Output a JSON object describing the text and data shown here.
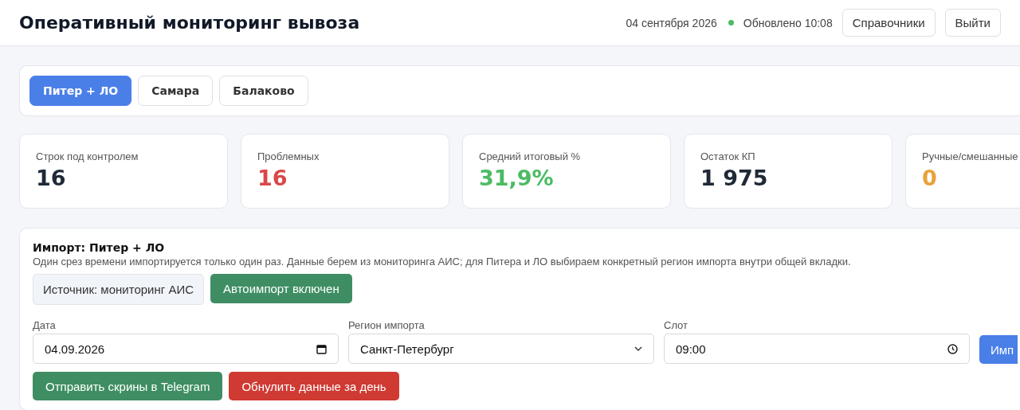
{
  "header": {
    "title": "Оперативный мониторинг вывоза",
    "date": "04 сентября 2026",
    "status": {
      "online": true,
      "text": "Обновлено 10:08"
    },
    "buttons": [
      "Справочники",
      "Выйти"
    ]
  },
  "tabs": [
    {
      "label": "Питер + ЛО",
      "selected": true
    },
    {
      "label": "Самара",
      "selected": false
    },
    {
      "label": "Балаково",
      "selected": false
    }
  ],
  "stats": [
    {
      "label": "Строк под контролем",
      "value": "16",
      "color": "#1f2937"
    },
    {
      "label": "Проблемных",
      "value": "16",
      "color": "#d94848"
    },
    {
      "label": "Средний итоговый %",
      "value": "31,9%",
      "color": "#4cbb63"
    },
    {
      "label": "Остаток КП",
      "value": "1 975",
      "color": "#1f2937"
    },
    {
      "label": "Ручные/смешанные",
      "value": "0",
      "color": "#e8a23b"
    }
  ],
  "import": {
    "title": "Импорт: Питер + ЛО",
    "description": "Один срез времени импортируется только один раз. Данные берем из мониторинга АИС; для Питера и ЛО выбираем конкретный регион импорта внутри общей вкладки.",
    "source": "Источник: мониторинг АИС",
    "autoimport": {
      "on": true,
      "label": "Автоимпорт включен"
    },
    "fields": [
      {
        "kind": "date",
        "label": "Дата",
        "value": "04.09.2026"
      },
      {
        "kind": "select",
        "label": "Регион импорта",
        "value": "Санкт-Петербург"
      },
      {
        "kind": "time",
        "label": "Слот",
        "value": "09:00"
      }
    ],
    "submit": "Имп",
    "actions": [
      {
        "label": "Отправить скрины в Telegram",
        "kind": "success"
      },
      {
        "label": "Обнулить данные за день",
        "kind": "danger"
      }
    ]
  }
}
